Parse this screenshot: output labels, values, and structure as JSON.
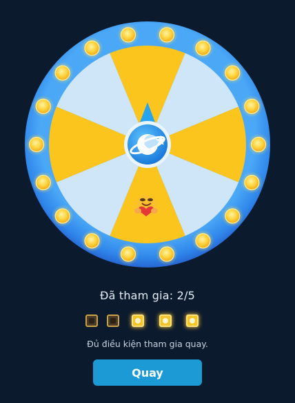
{
  "wheel": {
    "segment_colors": [
      "#fcc51d",
      "#cfe5f8"
    ],
    "ring_color": "#2f86ea",
    "bulb_color": "#ffd43d",
    "hub_color": "#1e93e8",
    "pointer_color": "#27a4ef",
    "center_icon": "planet-logo-icon",
    "avatar_icon": "heart-hug-emoji-icon"
  },
  "participants": {
    "label": "Đã tham gia: 2/5",
    "slots": [
      "empty",
      "empty",
      "filled",
      "filled",
      "filled"
    ]
  },
  "status": {
    "message": "Đủ điều kiện tham gia quay."
  },
  "spin_button": {
    "label": "Quay"
  }
}
